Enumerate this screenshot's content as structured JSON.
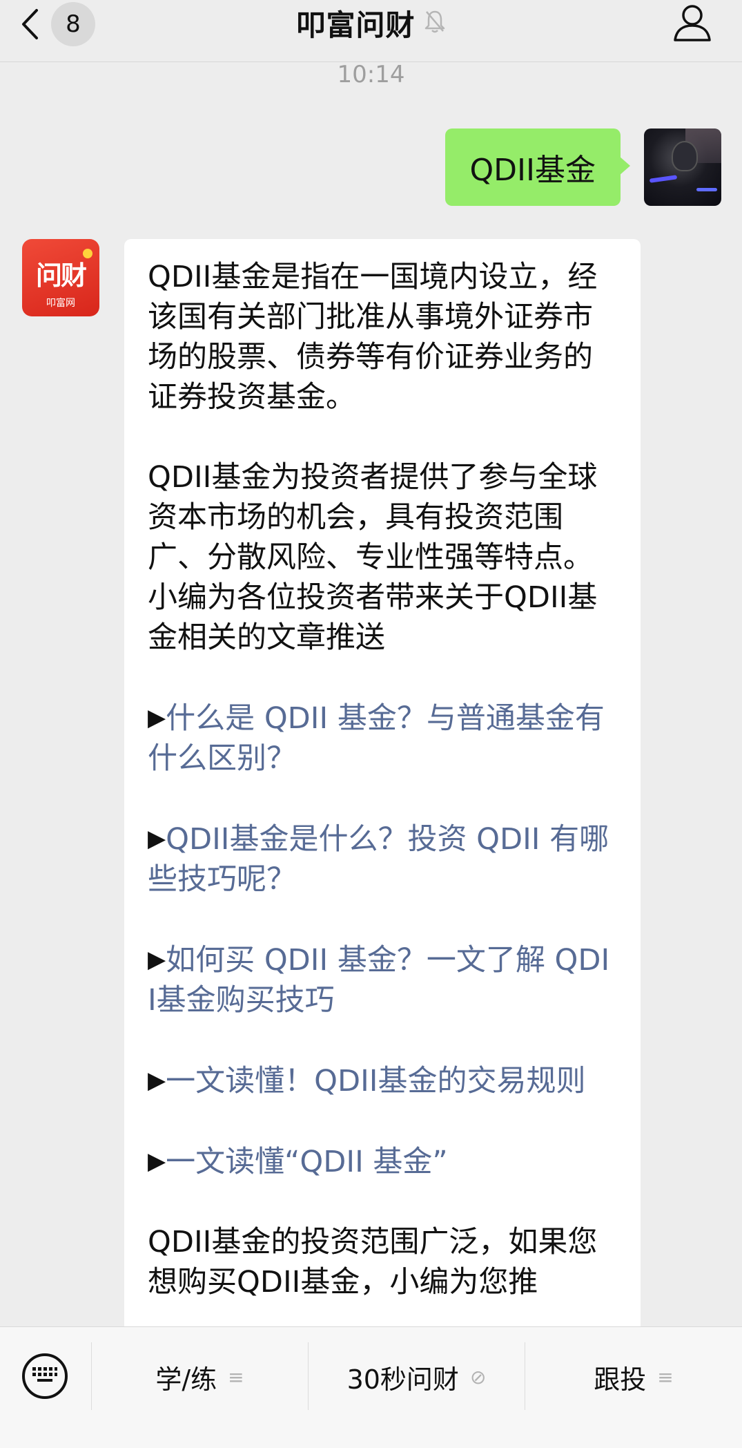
{
  "header": {
    "unread_count": "8",
    "title": "叩富问财",
    "muted": true
  },
  "chat": {
    "timestamp": "10:14",
    "sent_message": "QDII基金",
    "bot_avatar": {
      "main_text": "问财",
      "sub_text": "叩富网",
      "color": "#e23a2a"
    },
    "reply": {
      "paragraphs": [
        "QDII基金是指在一国境内设立，经该国有关部门批准从事境外证券市场的股票、债券等有价证券业务的证券投资基金。",
        "QDII基金为投资者提供了参与全球资本市场的机会，具有投资范围广、分散风险、专业性强等特点。小编为各位投资者带来关于QDII基金相关的文章推送"
      ],
      "arrow_glyph": "▶",
      "links": [
        "什么是 QDII 基金？与普通基金有什么区别？",
        "QDII基金是什么？投资 QDII 有哪些技巧呢？",
        "如何买 QDII 基金？一文了解 QDII基金购买技巧",
        "一文读懂！QDII基金的交易规则",
        "一文读懂“QDII 基金”"
      ],
      "closing_paragraph": "QDII基金的投资范围广泛，如果您想购买QDII基金，小编为您推"
    }
  },
  "bottom_menu": {
    "items": [
      {
        "label": "学/练",
        "suffix": "≡"
      },
      {
        "label": "30秒问财",
        "suffix": "⊘"
      },
      {
        "label": "跟投",
        "suffix": "≡"
      }
    ]
  },
  "colors": {
    "background": "#ededed",
    "sent_bubble": "#95ec69",
    "link": "#576b95"
  }
}
